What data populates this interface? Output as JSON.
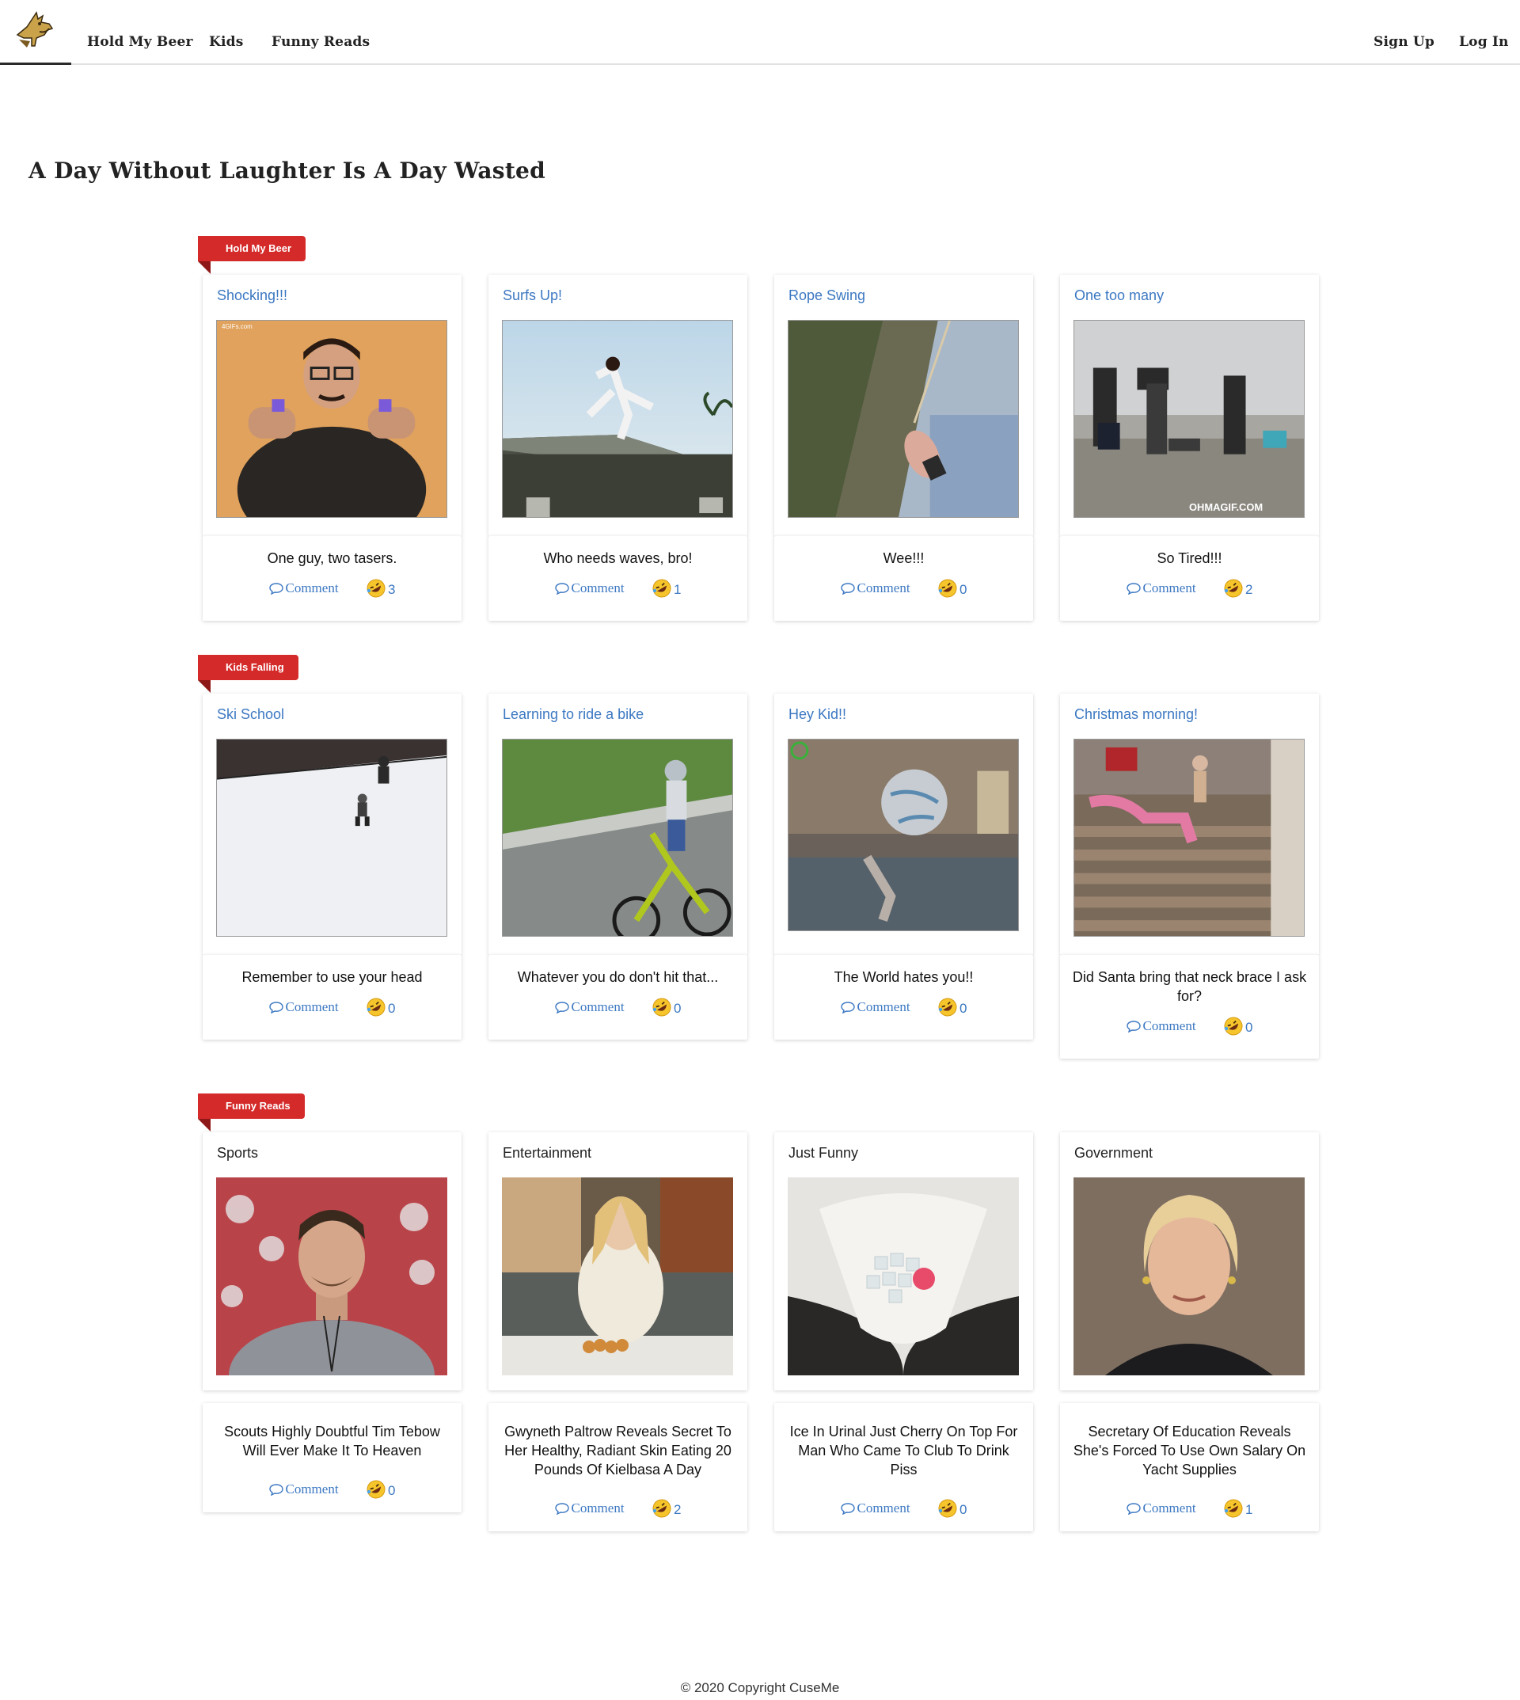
{
  "nav": {
    "links": [
      "Hold My Beer",
      "Kids",
      "Funny Reads"
    ],
    "sign_up": "Sign Up",
    "log_in": "Log In"
  },
  "headline": "A Day Without Laughter Is A Day Wasted",
  "sections": [
    {
      "label": "Hold My Beer",
      "cards": [
        {
          "title": "Shocking!!!",
          "caption": "One guy, two tasers.",
          "comment": "Comment",
          "laughs": "3"
        },
        {
          "title": "Surfs Up!",
          "caption": "Who needs waves, bro!",
          "comment": "Comment",
          "laughs": "1"
        },
        {
          "title": "Rope Swing",
          "caption": "Wee!!!",
          "comment": "Comment",
          "laughs": "0"
        },
        {
          "title": "One too many",
          "caption": "So Tired!!!",
          "comment": "Comment",
          "laughs": "2"
        }
      ]
    },
    {
      "label": "Kids Falling",
      "cards": [
        {
          "title": "Ski School",
          "caption": "Remember to use your head",
          "comment": "Comment",
          "laughs": "0"
        },
        {
          "title": "Learning to ride a bike",
          "caption": "Whatever you do don't hit that...",
          "comment": "Comment",
          "laughs": "0"
        },
        {
          "title": "Hey Kid!!",
          "caption": "The World hates you!!",
          "comment": "Comment",
          "laughs": "0"
        },
        {
          "title": "Christmas morning!",
          "caption": "Did Santa bring that neck brace I ask for?",
          "comment": "Comment",
          "laughs": "0"
        }
      ]
    },
    {
      "label": "Funny Reads",
      "cards": [
        {
          "title": "Sports",
          "caption": "Scouts Highly Doubtful Tim Tebow Will Ever Make It To Heaven",
          "comment": "Comment",
          "laughs": "0"
        },
        {
          "title": "Entertainment",
          "caption": "Gwyneth Paltrow Reveals Secret To Her Healthy, Radiant Skin Eating 20 Pounds Of Kielbasa A Day",
          "comment": "Comment",
          "laughs": "2"
        },
        {
          "title": "Just Funny",
          "caption": "Ice In Urinal Just Cherry On Top For Man Who Came To Club To Drink Piss",
          "comment": "Comment",
          "laughs": "0"
        },
        {
          "title": "Government",
          "caption": "Secretary Of Education Reveals She's Forced To Use Own Salary On Yacht Supplies",
          "comment": "Comment",
          "laughs": "1"
        }
      ]
    }
  ],
  "media_watermarks": {
    "gif_credit": "4GIFs.com",
    "ohmagif": "OHMAGIF.COM"
  },
  "footer": "© 2020 Copyright CuseMe"
}
